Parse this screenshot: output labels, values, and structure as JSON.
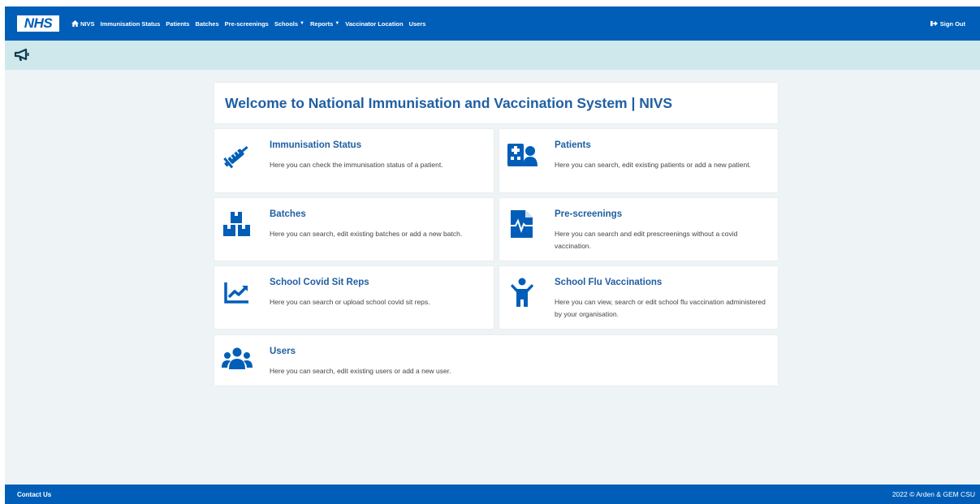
{
  "nav": {
    "logo": "NHS",
    "links": [
      {
        "label": "NIVS"
      },
      {
        "label": "Immunisation Status"
      },
      {
        "label": "Patients"
      },
      {
        "label": "Batches"
      },
      {
        "label": "Pre-screenings"
      },
      {
        "label": "Schools"
      },
      {
        "label": "Reports"
      },
      {
        "label": "Vaccinator Location"
      },
      {
        "label": "Users"
      }
    ],
    "sign_out": "Sign Out"
  },
  "main": {
    "title": "Welcome to National Immunisation and Vaccination System | NIVS",
    "cards": [
      {
        "icon": "syringe-icon",
        "title": "Immunisation Status",
        "desc": "Here you can check the immunisation status of a patient."
      },
      {
        "icon": "hospital-user-icon",
        "title": "Patients",
        "desc": "Here you can search, edit existing patients or add a new patient."
      },
      {
        "icon": "boxes-icon",
        "title": "Batches",
        "desc": "Here you can search, edit existing batches or add a new batch."
      },
      {
        "icon": "file-medical-alt-icon",
        "title": "Pre-screenings",
        "desc": "Here you can search and edit prescreenings without a covid vaccination."
      },
      {
        "icon": "chart-line-icon",
        "title": "School Covid Sit Reps",
        "desc": "Here you can search or upload school covid sit reps."
      },
      {
        "icon": "child-icon",
        "title": "School Flu Vaccinations",
        "desc": "Here you can view, search or edit school flu vaccination administered by your organisation."
      },
      {
        "icon": "users-icon",
        "title": "Users",
        "desc": "Here you can search, edit existing users or add a new user."
      }
    ]
  },
  "footer": {
    "contact": "Contact Us",
    "copyright": "2022 © Arden & GEM CSU"
  },
  "colors": {
    "brand_blue": "#005eb8",
    "announce_bg": "#cfe8ec",
    "page_bg": "#eef3f5",
    "title_blue": "#1f5fa3"
  }
}
